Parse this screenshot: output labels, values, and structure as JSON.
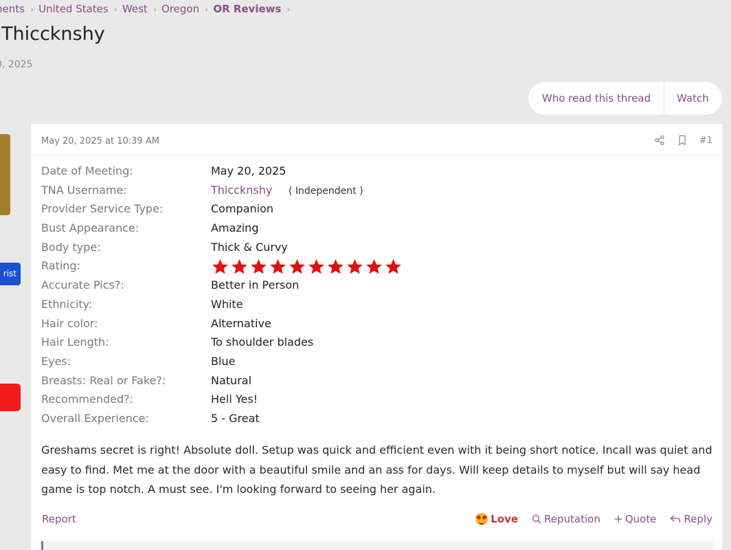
{
  "breadcrumb": {
    "items": [
      "nents",
      "United States",
      "West",
      "Oregon",
      "OR Reviews"
    ]
  },
  "thread": {
    "title": "Thicc​knshy",
    "date": "0, 2025"
  },
  "thread_actions": {
    "who_read": "Who read this thread",
    "watch": "Watch"
  },
  "sidebar": {
    "badge_text": "rist"
  },
  "post": {
    "timestamp": "May 20, 2025 at 10:39 AM",
    "number": "#1",
    "fields": [
      {
        "label": "Date of Meeting:",
        "value": "May 20, 2025"
      },
      {
        "label": "TNA Username:",
        "value": "Thiccknshy",
        "tag": "( Independent )"
      },
      {
        "label": "Provider Service Type:",
        "value": "Companion"
      },
      {
        "label": "Bust Appearance:",
        "value": "Amazing"
      },
      {
        "label": "Body type:",
        "value": "Thick & Curvy"
      },
      {
        "label": "Rating:",
        "rating": 10,
        "rating_max": 10
      },
      {
        "label": "Accurate Pics?:",
        "value": "Better in Person"
      },
      {
        "label": "Ethnicity:",
        "value": "White"
      },
      {
        "label": "Hair color:",
        "value": "Alternative"
      },
      {
        "label": "Hair Length:",
        "value": "To shoulder blades"
      },
      {
        "label": "Eyes:",
        "value": "Blue"
      },
      {
        "label": "Breasts: Real or Fake?:",
        "value": "Natural"
      },
      {
        "label": "Recommended?:",
        "value": "Hell Yes!"
      },
      {
        "label": "Overall Experience:",
        "value": "5 - Great"
      }
    ],
    "body": "Greshams secret is right! Absolute doll. Setup was quick and efficient even with it being short notice. Incall was quiet and easy to find. Met me at the door with a beautiful smile and an ass for days. Will keep details to myself but will say head game is top notch. A must see. I'm looking forward to seeing her again.",
    "footer": {
      "report": "Report",
      "love": "Love",
      "reputation": "Reputation",
      "quote": "Quote",
      "reply": "Reply"
    }
  },
  "colors": {
    "link": "#8a4f86",
    "star": "#e01010",
    "love": "#cc2f2f"
  },
  "icons": [
    "share-icon",
    "bookmark-icon",
    "star-icon",
    "love-emoji-icon",
    "search-icon",
    "plus-icon",
    "reply-icon"
  ]
}
